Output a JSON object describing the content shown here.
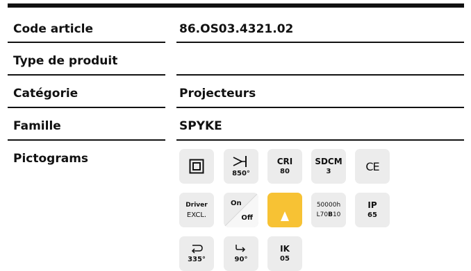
{
  "rows": [
    {
      "label": "Code article",
      "value": "86.OS03.4321.02"
    },
    {
      "label": "Type de produit",
      "value": ""
    },
    {
      "label": "Catégorie",
      "value": "Projecteurs"
    },
    {
      "label": "Famille",
      "value": "SPYKE"
    },
    {
      "label": "Pictograms",
      "value": ""
    }
  ],
  "pictograms": {
    "beam_angle": "850°",
    "cri_title": "CRI",
    "cri_value": "80",
    "sdcm_title": "SDCM",
    "sdcm_value": "3",
    "ce_mark": "CE",
    "driver_title": "Driver",
    "driver_value": "EXCL.",
    "on_label": "On",
    "off_label": "Off",
    "lifetime_hours": "50000h",
    "lifetime_prefix": "L70",
    "lifetime_b": "B",
    "lifetime_suffix": "10",
    "ip_title": "IP",
    "ip_value": "65",
    "rotation_value": "335°",
    "tilt_value": "90°",
    "ik_title": "IK",
    "ik_value": "05"
  },
  "colors": {
    "tile_bg": "#ececec",
    "accent_yellow": "#f7c234",
    "text": "#111111"
  }
}
